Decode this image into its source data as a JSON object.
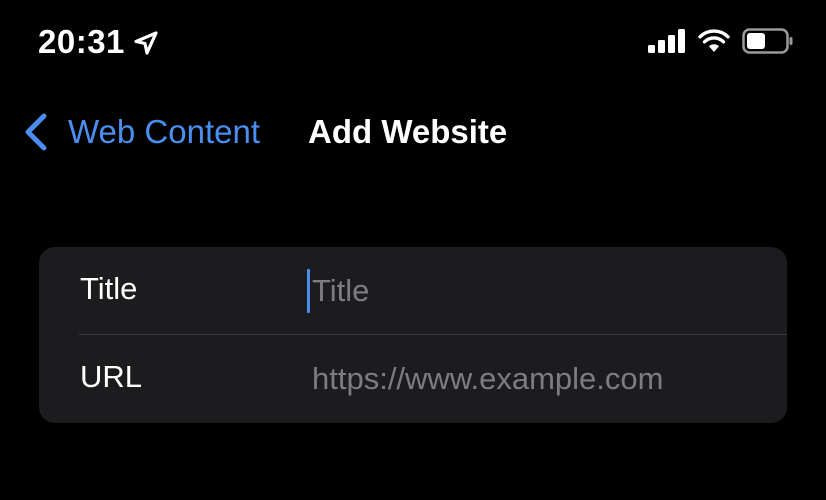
{
  "status_bar": {
    "time": "20:31",
    "icons": [
      "location-arrow-icon",
      "cellular-signal-icon",
      "wifi-icon",
      "battery-icon"
    ]
  },
  "nav": {
    "back_label": "Web Content",
    "title": "Add Website"
  },
  "form": {
    "fields": [
      {
        "label": "Title",
        "value": "",
        "placeholder": "Title",
        "focused": true
      },
      {
        "label": "URL",
        "value": "",
        "placeholder": "https://www.example.com",
        "focused": false
      }
    ]
  },
  "colors": {
    "accent": "#4a8ff0",
    "background": "#000000",
    "card": "#1c1c1e",
    "placeholder": "#7c7c82"
  }
}
